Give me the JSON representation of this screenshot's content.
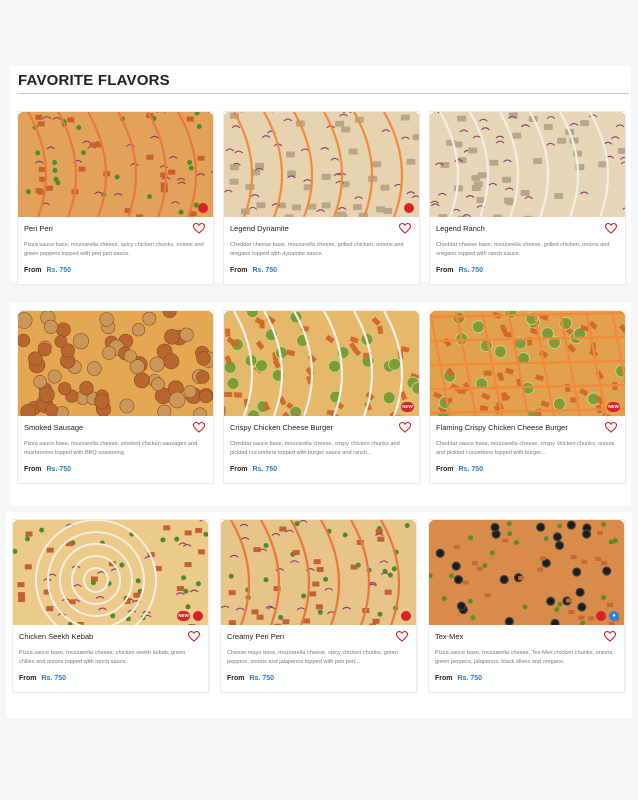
{
  "section": {
    "title": "FAVORITE FLAVORS"
  },
  "price_prefix": "From",
  "colors": {
    "accent": "#2c7fb8",
    "spicy": "#d6232a",
    "veg": "#2d7fd8",
    "heart": "#d6232a"
  },
  "items": [
    {
      "name": "Peri Peri",
      "desc": "Pizza sauce base, mozzarella cheese, spicy chicken chunks, onions and green peppers topped with peri peri sauce.",
      "price": "Rs. 750",
      "badges": [
        "spicy"
      ]
    },
    {
      "name": "Legend Dynamite",
      "desc": "Cheddar cheese base, mozzarella cheese, grilled chicken, onions and oregano topped with dynamite sauce.",
      "price": "Rs. 750",
      "badges": [
        "spicy"
      ]
    },
    {
      "name": "Legend Ranch",
      "desc": "Cheddar cheese base, mozzarella cheese, grilled chicken, onions and oregano topped with ranch sauce.",
      "price": "Rs. 750",
      "badges": []
    },
    {
      "name": "Smoked Sausage",
      "desc": "Pizza sauce base, mozzarella cheese, smoked chicken sausages and mushrooms topped with BBQ seasoning.",
      "price": "Rs. 750",
      "badges": []
    },
    {
      "name": "Crispy Chicken Cheese Burger",
      "desc": "Cheddar sauce base, mozzarella cheese, crispy chicken chunks and pickled cucumbers topped with burger sauce and ranch...",
      "price": "Rs. 750",
      "badges": [
        "new"
      ]
    },
    {
      "name": "Flaming Crispy Chicken Cheese Burger",
      "desc": "Cheddar sauce base, mozzarella cheese, crispy chicken chunks, onions and pickled cucumbers topped with burger...",
      "price": "Rs. 750",
      "badges": [
        "new"
      ]
    },
    {
      "name": "Chicken Seekh Kebab",
      "desc": "Pizza sauce base, mozzarella cheese, chicken seekh kebab, green chilies and onions topped with ranch sauce.",
      "price": "Rs. 750",
      "badges": [
        "new",
        "spicy"
      ]
    },
    {
      "name": "Creamy Peri Peri",
      "desc": "Cheese mayo base, mozzarella cheese, spicy chicken chunks, green peppers, onions and jalapenos topped with peri peri...",
      "price": "Rs. 750",
      "badges": [
        "spicy"
      ]
    },
    {
      "name": "Tex-Mex",
      "desc": "Pizza sauce base, mozzarella cheese, Tex-Mex chicken chunks, onions, green peppers, jalapenos, black olives and oregano.",
      "price": "Rs. 750",
      "badges": [
        "spicy",
        "veg"
      ]
    }
  ]
}
